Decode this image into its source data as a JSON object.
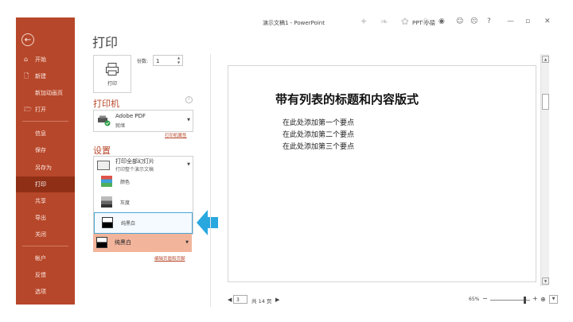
{
  "window": {
    "title": "演示文稿1 - PowerPoint",
    "user": "PPT 小猿",
    "help": "?",
    "minimize": "—",
    "restore": "▫",
    "close": "✕"
  },
  "sidebar": {
    "back_icon": "arrow-left-icon",
    "items": [
      {
        "label": "开始",
        "icon": "⌂"
      },
      {
        "label": "新建",
        "icon": "🗋"
      },
      {
        "label": "新加动画页",
        "icon": ""
      },
      {
        "label": "打开",
        "icon": "🗁"
      },
      {
        "label": "信息",
        "icon": ""
      },
      {
        "label": "保存",
        "icon": ""
      },
      {
        "label": "另存为",
        "icon": ""
      },
      {
        "label": "打印",
        "icon": "",
        "active": true
      },
      {
        "label": "共享",
        "icon": ""
      },
      {
        "label": "导出",
        "icon": ""
      },
      {
        "label": "关闭",
        "icon": ""
      },
      {
        "label": "帐户",
        "icon": ""
      },
      {
        "label": "反馈",
        "icon": ""
      },
      {
        "label": "选项",
        "icon": ""
      }
    ]
  },
  "print_panel": {
    "heading": "打印",
    "print_button": "打印",
    "copies_label": "份数:",
    "copies_value": "1",
    "printer_heading": "打印机",
    "printer_name": "Adobe PDF",
    "printer_status": "就绪",
    "printer_properties": "打印机属性",
    "settings_heading": "设置",
    "slides_option": "打印全部幻灯片",
    "slides_desc": "打印整个演示文稿",
    "color_options": [
      "颜色",
      "灰度",
      "纯黑白"
    ],
    "color_selected": "纯黑白",
    "header_footer_link": "编辑页眉和页脚"
  },
  "preview": {
    "slide_title": "带有列表的标题和内容版式",
    "bullets": [
      "在此处添加第一个要点",
      "在此处添加第二个要点",
      "在此处添加第三个要点"
    ],
    "page_current": "3",
    "page_total": "共 14 页",
    "zoom": "65%"
  },
  "colors": {
    "accent": "#b7472a",
    "sidebar_active": "#8f2f16",
    "highlight_arrow": "#29a8e0",
    "selected_option": "#f2b59c"
  }
}
